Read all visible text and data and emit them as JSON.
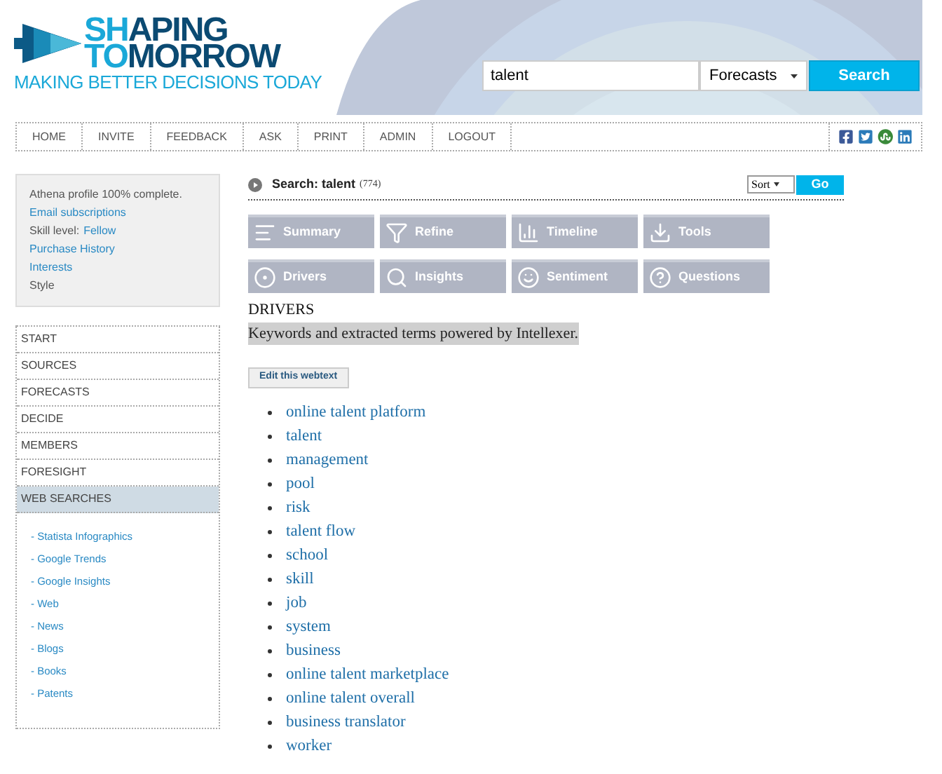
{
  "logo": {
    "segments": [
      {
        "text": "SH",
        "accent": true
      },
      {
        "text": "APING",
        "accent": false
      }
    ],
    "segments2": [
      {
        "text": "TO",
        "accent": true
      },
      {
        "text": "MORROW",
        "accent": false
      }
    ],
    "tagline": "MAKING BETTER DECISIONS TODAY"
  },
  "search": {
    "value": "talent",
    "scope": "Forecasts",
    "button": "Search"
  },
  "nav": [
    "HOME",
    "INVITE",
    "FEEDBACK",
    "ASK",
    "PRINT",
    "ADMIN",
    "LOGOUT"
  ],
  "profile": [
    {
      "kind": "text",
      "text": "Athena profile 100% complete."
    },
    {
      "kind": "link",
      "text": "Email subscriptions"
    },
    {
      "kind": "pair",
      "text": "Skill level:",
      "value": "Fellow"
    },
    {
      "kind": "link",
      "text": "Purchase History"
    },
    {
      "kind": "link",
      "text": "Interests"
    },
    {
      "kind": "text",
      "text": "Style"
    }
  ],
  "sidebar": {
    "items": [
      {
        "label": "START",
        "selected": false
      },
      {
        "label": "SOURCES",
        "selected": false
      },
      {
        "label": "FORECASTS",
        "selected": false
      },
      {
        "label": "DECIDE",
        "selected": false
      },
      {
        "label": "MEMBERS",
        "selected": false
      },
      {
        "label": "FORESIGHT",
        "selected": false
      },
      {
        "label": "WEB SEARCHES",
        "selected": true
      }
    ],
    "web_searches": [
      "- Statista Infographics",
      "- Google Trends",
      "- Google Insights",
      "- Web",
      "- News",
      "- Blogs",
      "- Books",
      "- Patents"
    ]
  },
  "results": {
    "title": "Search: talent",
    "count": "(774)",
    "sort": "Sort",
    "go": "Go"
  },
  "tabs": [
    {
      "label": "Summary",
      "kind": "summary"
    },
    {
      "label": "Refine",
      "kind": "refine"
    },
    {
      "label": "Timeline",
      "kind": "timeline"
    },
    {
      "label": "Tools",
      "kind": "tools"
    },
    {
      "label": "Drivers",
      "kind": "drivers"
    },
    {
      "label": "Insights",
      "kind": "insights"
    },
    {
      "label": "Sentiment",
      "kind": "sentiment"
    },
    {
      "label": "Questions",
      "kind": "questions"
    }
  ],
  "section": {
    "heading": "DRIVERS",
    "subtitle": "Keywords and extracted terms powered by Intellexer.",
    "edit_button": "Edit this webtext"
  },
  "keywords": [
    "online talent platform",
    "talent",
    "management",
    "pool",
    "risk",
    "talent flow",
    "school",
    "skill",
    "job",
    "system",
    "business",
    "online talent marketplace",
    "online talent overall",
    "business translator",
    "worker"
  ]
}
